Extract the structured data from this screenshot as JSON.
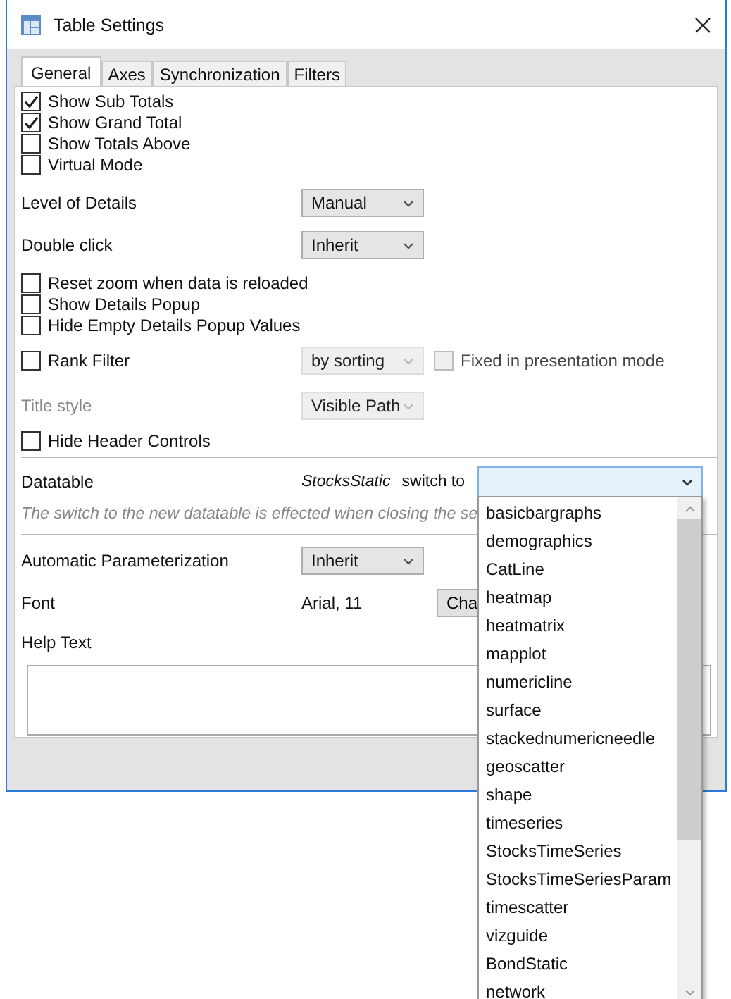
{
  "window": {
    "title": "Table Settings"
  },
  "tabs": [
    {
      "label": "General",
      "selected": true
    },
    {
      "label": "Axes",
      "selected": false
    },
    {
      "label": "Synchronization",
      "selected": false
    },
    {
      "label": "Filters",
      "selected": false
    }
  ],
  "display_options": [
    {
      "label": "Show Sub Totals",
      "checked": true
    },
    {
      "label": "Show Grand Total",
      "checked": true
    },
    {
      "label": "Show Totals Above",
      "checked": false
    },
    {
      "label": "Virtual Mode",
      "checked": false
    }
  ],
  "level_of_details": {
    "label": "Level of Details",
    "value": "Manual",
    "disabled": false
  },
  "double_click": {
    "label": "Double click",
    "value": "Inherit",
    "disabled": false
  },
  "popup_options": [
    {
      "label": "Reset zoom when data is reloaded",
      "checked": false
    },
    {
      "label": "Show Details Popup",
      "checked": false
    },
    {
      "label": "Hide Empty Details Popup Values",
      "checked": false
    }
  ],
  "rank_filter": {
    "label": "Rank Filter",
    "checked": false,
    "mode": {
      "value": "by sorting",
      "disabled": true
    },
    "fixed": {
      "label": "Fixed in presentation mode",
      "checked": false,
      "disabled": true
    }
  },
  "title_style": {
    "label": "Title style",
    "value": "Visible Path",
    "disabled": true
  },
  "hide_header_controls": {
    "label": "Hide Header Controls",
    "checked": false
  },
  "datatable": {
    "label": "Datatable",
    "current": "StocksStatic",
    "switch_label": "switch to",
    "hint": "The switch to the new datatable is effected when closing the se"
  },
  "automatic_parameterization": {
    "label": "Automatic Parameterization",
    "value": "Inherit",
    "disabled": false
  },
  "font": {
    "label": "Font",
    "value": "Arial, 11",
    "button": "Cha"
  },
  "help_text": {
    "label": "Help Text"
  },
  "datatable_list": [
    {
      "label": "basicbargraphs",
      "selected": false
    },
    {
      "label": "demographics",
      "selected": false
    },
    {
      "label": "CatLine",
      "selected": false
    },
    {
      "label": "heatmap",
      "selected": false
    },
    {
      "label": "heatmatrix",
      "selected": false
    },
    {
      "label": "mapplot",
      "selected": false
    },
    {
      "label": "numericline",
      "selected": false
    },
    {
      "label": "surface",
      "selected": false
    },
    {
      "label": "stackednumericneedle",
      "selected": false
    },
    {
      "label": "geoscatter",
      "selected": false
    },
    {
      "label": "shape",
      "selected": false
    },
    {
      "label": "timeseries",
      "selected": false
    },
    {
      "label": "StocksTimeSeries",
      "selected": false
    },
    {
      "label": "StocksTimeSeriesParam",
      "selected": false
    },
    {
      "label": "timescatter",
      "selected": false
    },
    {
      "label": "vizguide",
      "selected": false
    },
    {
      "label": "BondStatic",
      "selected": false
    },
    {
      "label": "network",
      "selected": false
    }
  ]
}
